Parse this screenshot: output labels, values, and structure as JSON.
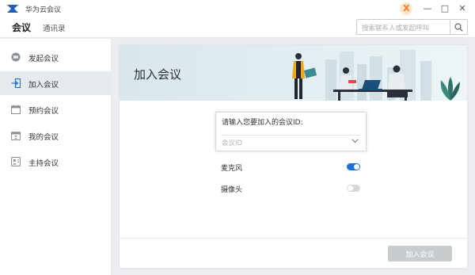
{
  "window": {
    "title": "华为云会议",
    "minimize_glyph": "—",
    "maximize_glyph": "□",
    "close_glyph": "✕",
    "brand_glyph": "X"
  },
  "topnav": {
    "tabs": [
      {
        "label": "会议",
        "active": true
      },
      {
        "label": "通讯录",
        "active": false
      }
    ],
    "search": {
      "placeholder": "搜索联系人或发起呼叫"
    }
  },
  "sidebar": {
    "items": [
      {
        "label": "发起会议",
        "icon": "camera-icon",
        "active": false
      },
      {
        "label": "加入会议",
        "icon": "enter-icon",
        "active": true
      },
      {
        "label": "预约会议",
        "icon": "calendar-icon",
        "active": false
      },
      {
        "label": "我的会议",
        "icon": "calendar-person-icon",
        "active": false
      },
      {
        "label": "主持会议",
        "icon": "host-icon",
        "active": false
      }
    ]
  },
  "main": {
    "banner_title": "加入会议",
    "meeting_id_label": "请输入您要加入的会议ID:",
    "meeting_id_placeholder": "会议ID",
    "options": [
      {
        "label": "麦克风",
        "enabled": true
      },
      {
        "label": "摄像头",
        "enabled": false
      }
    ],
    "join_button": "加入会议"
  },
  "colors": {
    "accent": "#1e6fd9",
    "disabled_button": "#c8cbd0",
    "brand_orange": "#f07a1e"
  }
}
